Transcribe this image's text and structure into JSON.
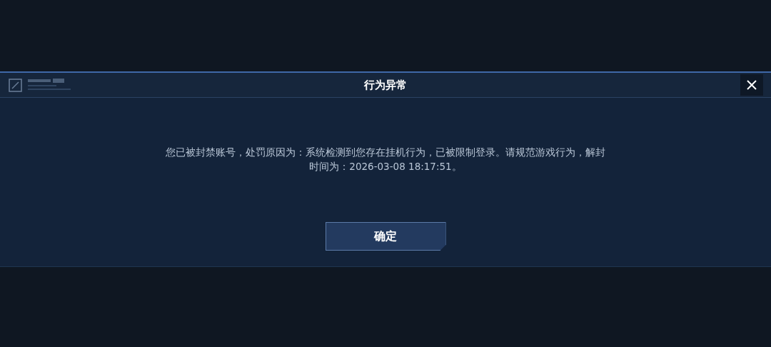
{
  "dialog": {
    "title": "行为异常",
    "message": "您已被封禁账号，处罚原因为：系统检测到您存在挂机行为，已被限制登录。请规范游戏行为，解封时间为：2026-03-08 18:17:51。",
    "buttons": [
      "确定"
    ]
  }
}
